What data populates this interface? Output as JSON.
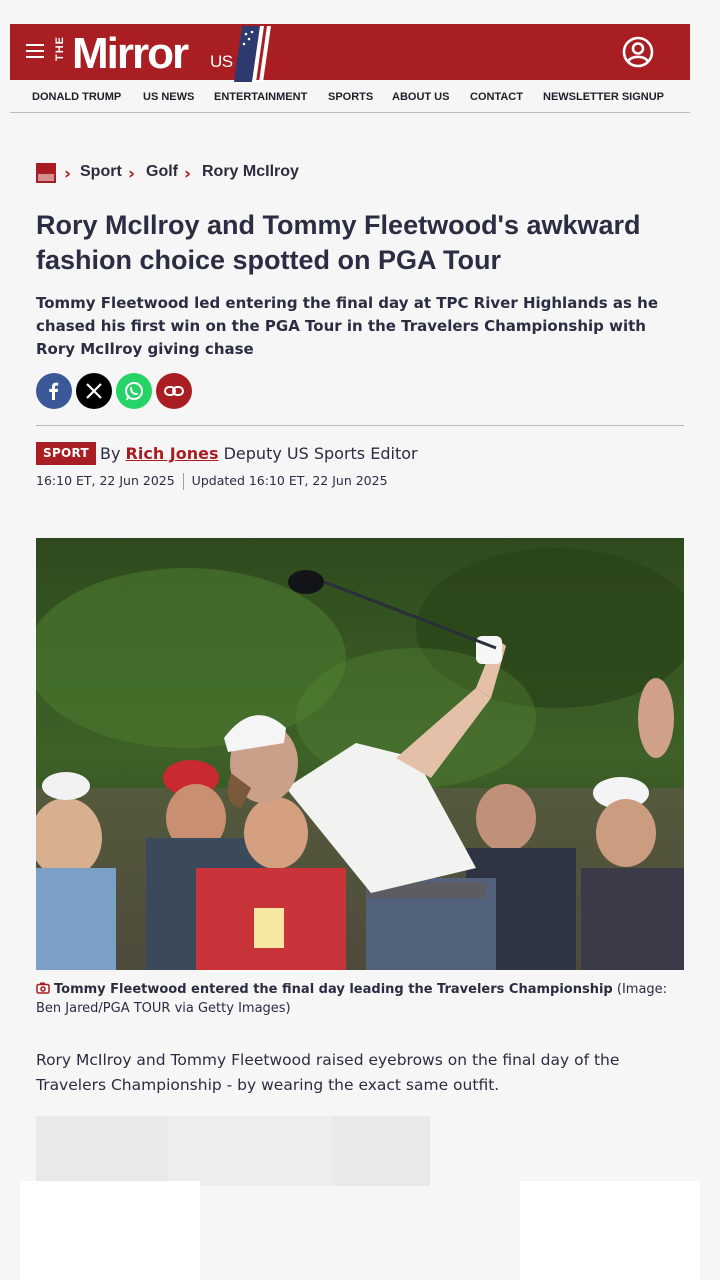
{
  "header": {
    "logo": {
      "the": "THE",
      "name": "Mirror",
      "edition": "US"
    },
    "menu_icon": "hamburger-menu-icon",
    "account_icon": "user-account-icon",
    "brand_color": "#a81e22"
  },
  "nav": {
    "items": [
      "DONALD TRUMP",
      "US NEWS",
      "ENTERTAINMENT",
      "SPORTS",
      "ABOUT US",
      "CONTACT",
      "NEWSLETTER SIGNUP"
    ]
  },
  "breadcrumb": {
    "items": [
      "Sport",
      "Golf",
      "Rory McIlroy"
    ]
  },
  "article": {
    "headline": "Rory McIlroy and Tommy Fleetwood's awkward fashion choice spotted on PGA Tour",
    "standfirst": "Tommy Fleetwood led entering the final day at TPC River Highlands as he chased his first win on the PGA Tour in the Travelers Championship with Rory McIlroy giving chase",
    "share": {
      "facebook_color": "#3b5998",
      "x_color": "#000000",
      "whatsapp_color": "#25d366",
      "link_color": "#a81e22"
    },
    "badge": "SPORT",
    "byline_prefix": "By",
    "author": "Rich Jones",
    "author_role": "Deputy US Sports Editor",
    "published": "16:10 ET, 22 Jun 2025",
    "updated": "Updated 16:10 ET, 22 Jun 2025",
    "caption_bold": "Tommy Fleetwood entered the final day leading the Travelers Championship",
    "caption_credit": "(Image: Ben Jared/PGA TOUR via Getty Images)",
    "body": "Rory McIlroy and Tommy Fleetwood raised eyebrows on the final day of the Travelers Championship - by wearing the exact same outfit."
  }
}
